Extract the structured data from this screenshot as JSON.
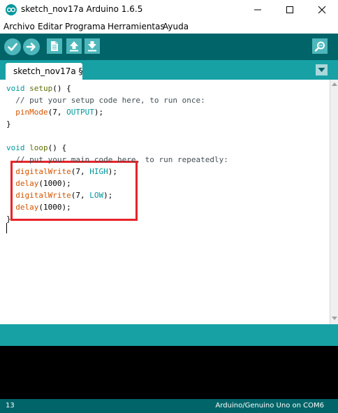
{
  "window": {
    "title": "sketch_nov17a Arduino 1.6.5",
    "controls": [
      "minimize-icon",
      "maximize-icon",
      "close-icon"
    ]
  },
  "menu": {
    "items": [
      "Archivo",
      "Editar",
      "Programa",
      "Herramientas",
      "Ayuda"
    ]
  },
  "toolbar": {
    "buttons": [
      "verify-icon",
      "upload-icon",
      "new-icon",
      "open-icon",
      "save-icon"
    ],
    "right_button": "serial-monitor-icon"
  },
  "tabs": {
    "active": "sketch_nov17a §",
    "menu_icon": "tab-menu-chevron-icon"
  },
  "editor": {
    "lines": [
      [
        {
          "t": "void",
          "c": "type"
        },
        {
          "t": " "
        },
        {
          "t": "setup",
          "c": "func"
        },
        {
          "t": "() {"
        }
      ],
      [
        {
          "t": "  "
        },
        {
          "t": "// put your setup code here, to run once:",
          "c": "comment"
        }
      ],
      [
        {
          "t": "  "
        },
        {
          "t": "pinMode",
          "c": "builtin"
        },
        {
          "t": "(7, "
        },
        {
          "t": "OUTPUT",
          "c": "const"
        },
        {
          "t": ");"
        }
      ],
      [
        {
          "t": "}"
        }
      ],
      [
        {
          "t": ""
        }
      ],
      [
        {
          "t": "void",
          "c": "type"
        },
        {
          "t": " "
        },
        {
          "t": "loop",
          "c": "func"
        },
        {
          "t": "() {"
        }
      ],
      [
        {
          "t": "  "
        },
        {
          "t": "// put your main code here, to run repeatedly:",
          "c": "comment"
        }
      ],
      [
        {
          "t": "  "
        },
        {
          "t": "digitalWrite",
          "c": "builtin"
        },
        {
          "t": "(7, "
        },
        {
          "t": "HIGH",
          "c": "const"
        },
        {
          "t": ");"
        }
      ],
      [
        {
          "t": "  "
        },
        {
          "t": "delay",
          "c": "builtin"
        },
        {
          "t": "(1000);"
        }
      ],
      [
        {
          "t": "  "
        },
        {
          "t": "digitalWrite",
          "c": "builtin"
        },
        {
          "t": "(7, "
        },
        {
          "t": "LOW",
          "c": "const"
        },
        {
          "t": ");"
        }
      ],
      [
        {
          "t": "  "
        },
        {
          "t": "delay",
          "c": "builtin"
        },
        {
          "t": "(1000);"
        }
      ],
      [
        {
          "t": "}"
        }
      ]
    ],
    "highlight_color": "#e8232b"
  },
  "status": {
    "line_number": "13",
    "board": "Arduino/Genuino Uno on COM6"
  },
  "colors": {
    "toolbar_bg": "#006468",
    "tabbar_bg": "#17a1a5",
    "button_bg": "#4db7bb",
    "console_bg": "#000000",
    "keyword_type": "#00979c",
    "keyword_builtin": "#d35400",
    "comment": "#434f54"
  }
}
